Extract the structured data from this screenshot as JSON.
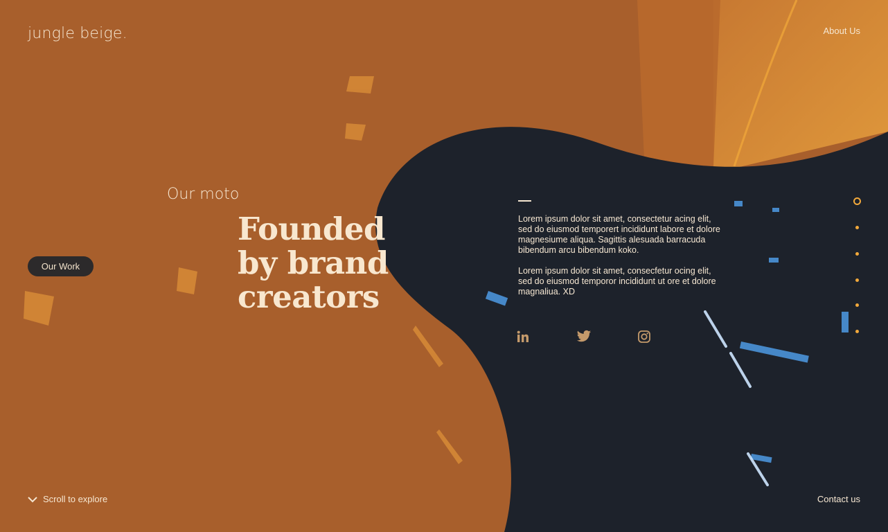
{
  "brand": {
    "logo": "jungle beige."
  },
  "nav": {
    "about": "About Us",
    "contact": "Contact us"
  },
  "hero": {
    "eyebrow": "Our moto",
    "headline_lines": [
      "Founded",
      "by brand",
      "creators"
    ]
  },
  "buttons": {
    "work": "Our Work"
  },
  "content": {
    "paragraph1": "Lorem ipsum dolor sit amet, consectetur acing elit, sed do eiusmod temporert incididunt labore et dolore magnesiume aliqua. Sagittis alesuada barracuda bibendum arcu bibendum koko.",
    "paragraph2": "Lorem ipsum dolor sit amet, consecfetur ocing elit, sed do eiusmod temporor incididunt ut ore et dolore magnaliua. XD"
  },
  "social": {
    "icons": [
      "linkedin-icon",
      "twitter-icon",
      "instagram-icon"
    ]
  },
  "pagination": {
    "total": 6,
    "active": 1
  },
  "footer": {
    "scroll_label": "Scroll to explore"
  },
  "colors": {
    "orange": "#a85f2c",
    "navy": "#1d222b",
    "cream": "#f6e7d2",
    "accent": "#f2a93b",
    "button": "#2c2a2b"
  }
}
